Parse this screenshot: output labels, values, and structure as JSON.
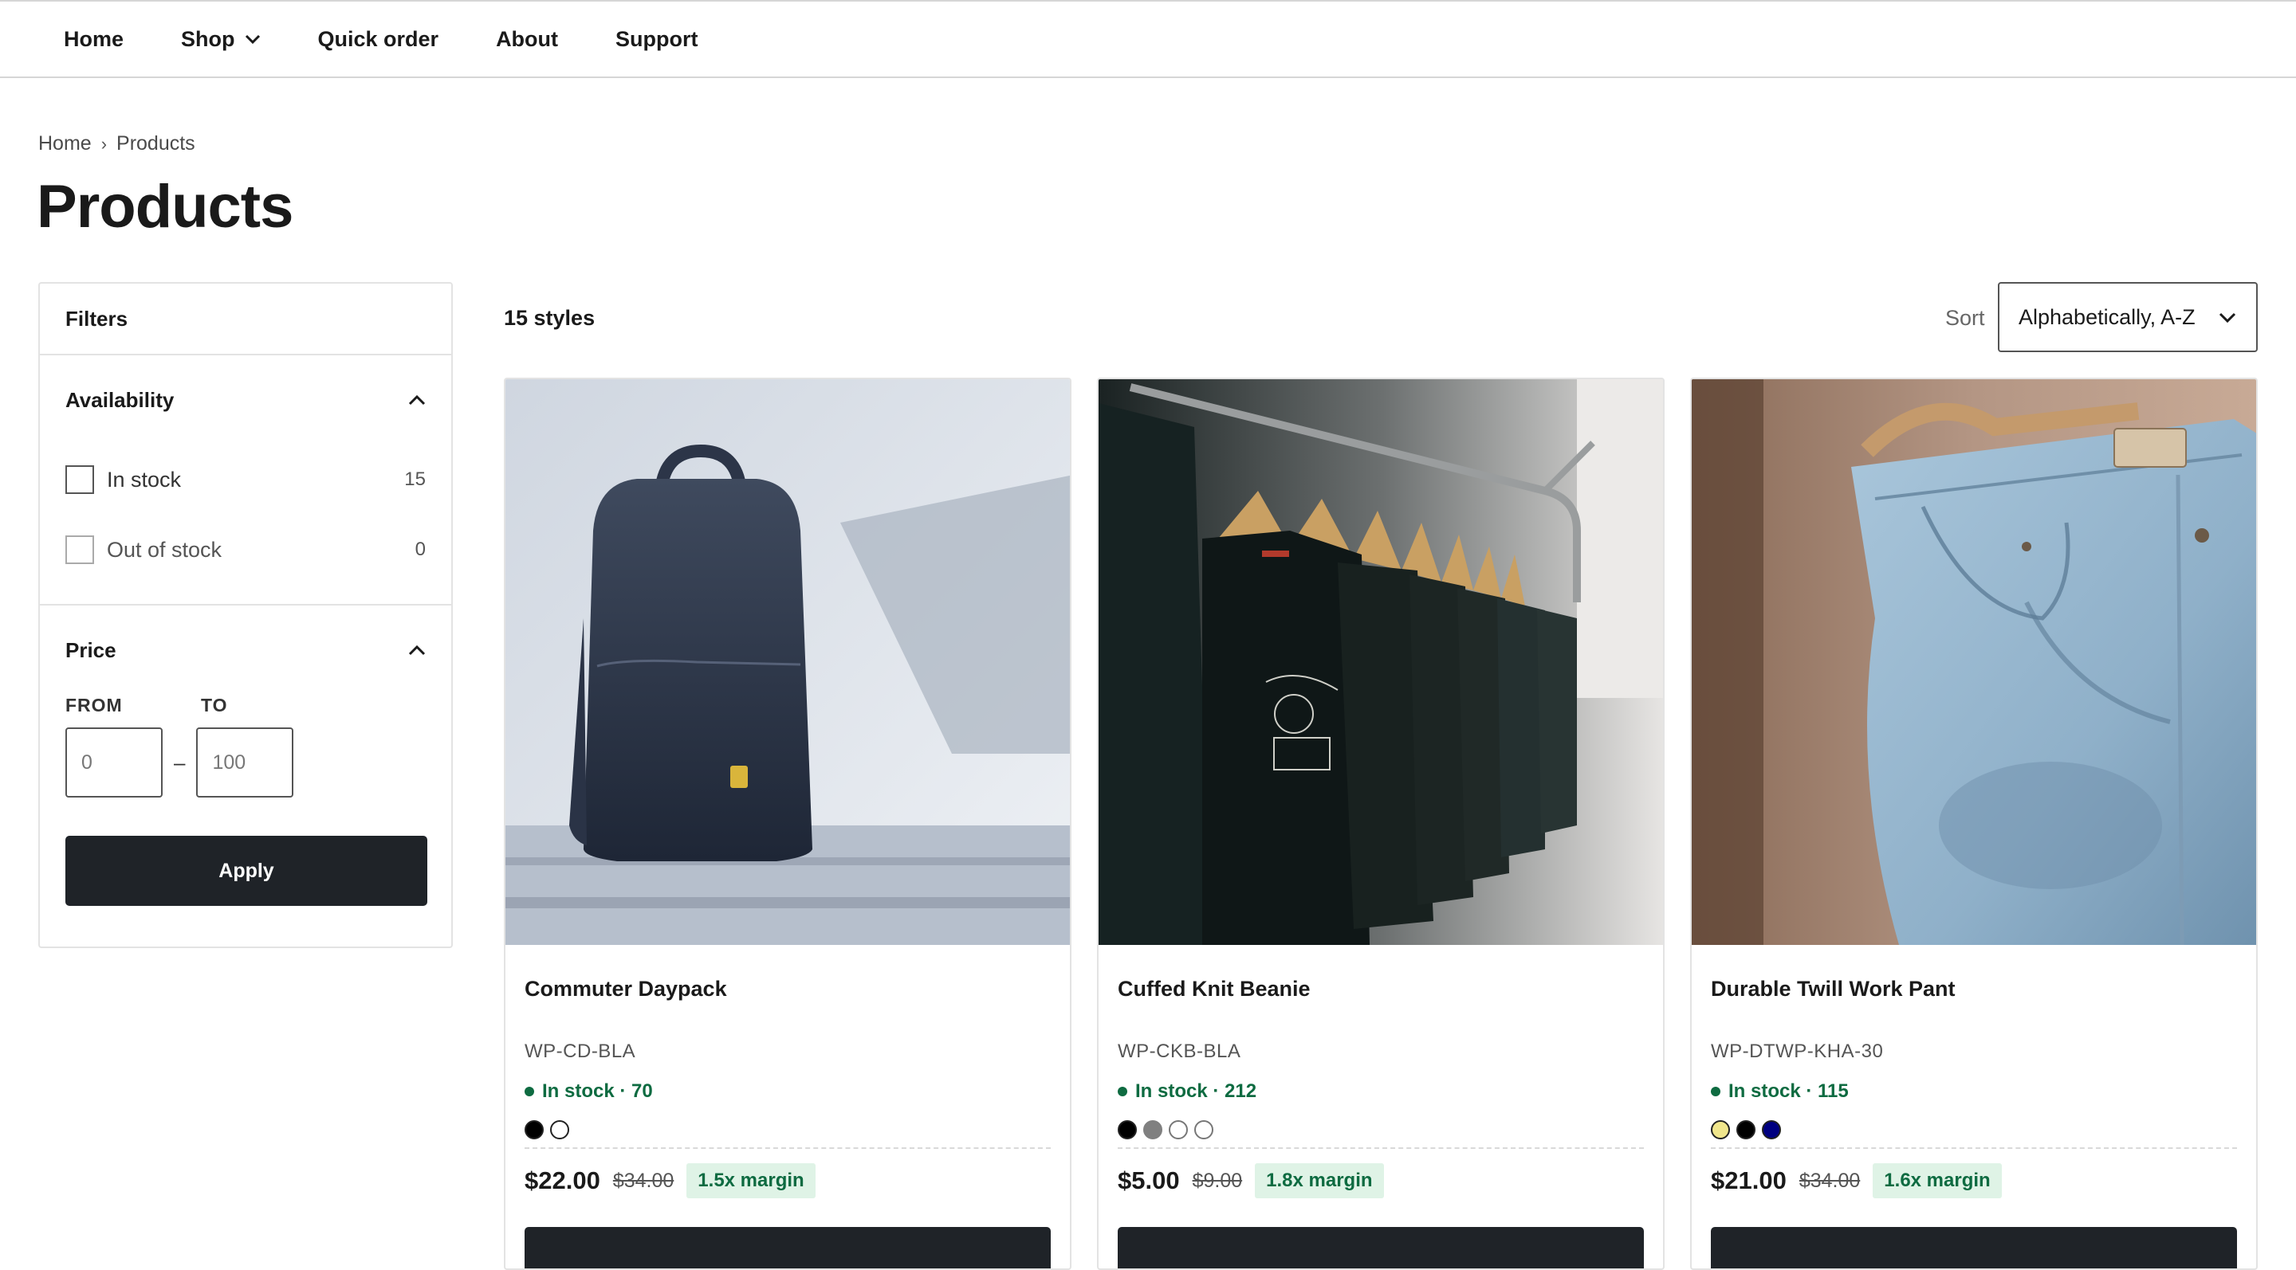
{
  "nav": {
    "items": [
      "Home",
      "Shop",
      "Quick order",
      "About",
      "Support"
    ]
  },
  "breadcrumb": {
    "home": "Home",
    "separator": "›",
    "current": "Products"
  },
  "page_title": "Products",
  "filters": {
    "title": "Filters",
    "availability": {
      "heading": "Availability",
      "options": [
        {
          "label": "In stock",
          "count": "15",
          "checked": false
        },
        {
          "label": "Out of stock",
          "count": "0",
          "checked": false
        }
      ]
    },
    "price": {
      "heading": "Price",
      "from_label": "FROM",
      "to_label": "TO",
      "from_placeholder": "0",
      "to_placeholder": "100",
      "dash": "–",
      "apply_label": "Apply"
    }
  },
  "results": {
    "count_label": "15 styles",
    "sort_label": "Sort",
    "sort_value": "Alphabetically, A-Z"
  },
  "products": [
    {
      "name": "Commuter Daypack",
      "sku": "WP-CD-BLA",
      "stock": "In stock · 70",
      "swatches": [
        "#000000",
        "#ffffff"
      ],
      "price": "$22.00",
      "compare_price": "$34.00",
      "margin": "1.5x margin",
      "image": "backpack"
    },
    {
      "name": "Cuffed Knit Beanie",
      "sku": "WP-CKB-BLA",
      "stock": "In stock · 212",
      "swatches": [
        "#000000",
        "#808080",
        "#ffffff",
        "#ffffff"
      ],
      "price": "$5.00",
      "compare_price": "$9.00",
      "margin": "1.8x margin",
      "image": "tshirts-on-rack"
    },
    {
      "name": "Durable Twill Work Pant",
      "sku": "WP-DTWP-KHA-30",
      "stock": "In stock · 115",
      "swatches": [
        "#f0e68c",
        "#000000",
        "#000080"
      ],
      "price": "$21.00",
      "compare_price": "$34.00",
      "margin": "1.6x margin",
      "image": "jeans-on-hanger"
    }
  ],
  "colors": {
    "accent_dark": "#1f2328",
    "stock_green": "#0e6b41",
    "margin_badge_bg": "#dff3e6"
  }
}
